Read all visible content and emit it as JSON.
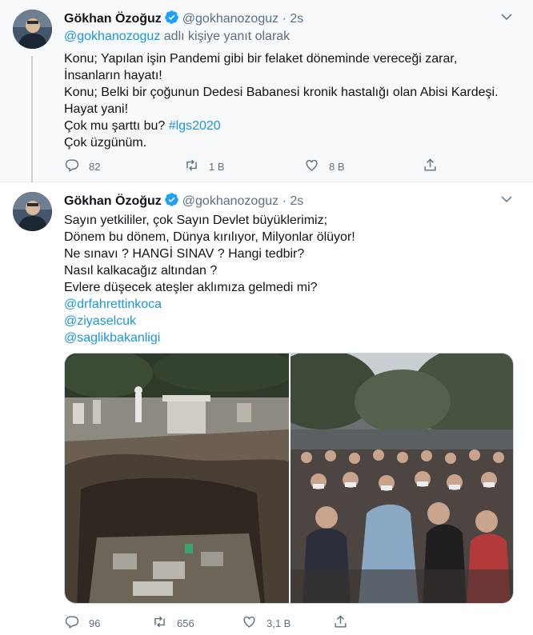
{
  "tweet1": {
    "author_name": "Gökhan Özoğuz",
    "handle": "@gokhanozoguz",
    "separator": "·",
    "time": "2s",
    "reply_mention": "@gokhanozoguz",
    "reply_suffix": " adlı kişiye yanıt olarak",
    "lines": [
      "Konu; Yapılan işin Pandemi gibi bir felaket döneminde vereceği zarar,",
      "İnsanların hayatı!",
      "Konu; Belki bir çoğunun Dedesi Babanesi kronik hastalığı olan Abisi Kardeşi.",
      "Hayat yani!",
      "Çok mu şarttı bu? ",
      "Çok üzgünüm."
    ],
    "hashtag": "#lgs2020",
    "replies": "82",
    "retweets": "1 B",
    "likes": "8 B"
  },
  "tweet2": {
    "author_name": "Gökhan Özoğuz",
    "handle": "@gokhanozoguz",
    "separator": "·",
    "time": "2s",
    "lines": [
      "Sayın yetkililer, çok Sayın Devlet büyüklerimiz;",
      "Dönem bu dönem, Dünya kırılıyor, Milyonlar ölüyor!",
      "Ne sınavı ? HANGİ SINAV ? Hangi tedbir?",
      "Nasıl kalkacağız altından ?",
      "Evlere düşecek ateşler aklımıza gelmedi mi?"
    ],
    "mentions": [
      "@drfahrettinkoca",
      "@ziyaselcuk",
      "@saglikbakanligi"
    ],
    "replies": "96",
    "retweets": "656",
    "likes": "3,1 B"
  },
  "icons": {
    "verified": "verified-badge-icon",
    "caret": "chevron-down-icon",
    "reply": "reply-icon",
    "retweet": "retweet-icon",
    "like": "heart-icon",
    "share": "share-icon"
  },
  "colors": {
    "link": "#1b95e0",
    "secondary_text": "#5b7083",
    "verified": "#1da1f2",
    "thread_bg": "#f7f9fa"
  }
}
